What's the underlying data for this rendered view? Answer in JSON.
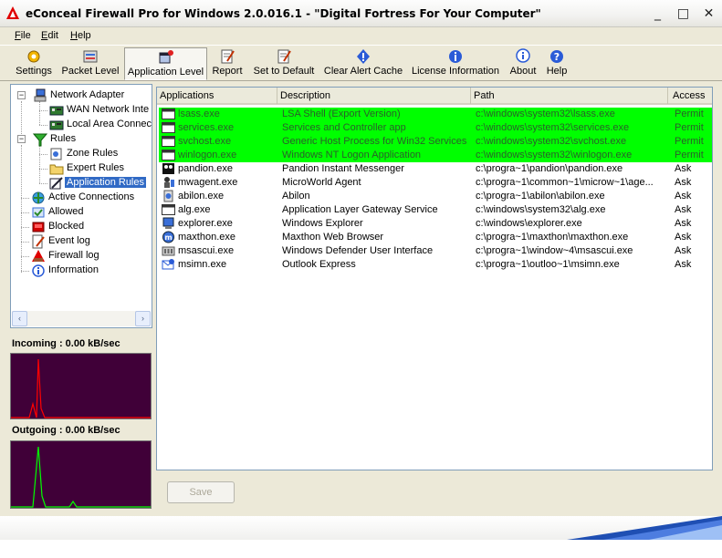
{
  "window": {
    "title": "eConceal Firewall Pro for Windows 2.0.016.1 - \"Digital Fortress For Your Computer\"",
    "minimize": "_",
    "maximize": "□",
    "close": "✕"
  },
  "menu": [
    {
      "label": "File",
      "accel": "F",
      "rest": "ile"
    },
    {
      "label": "Edit",
      "accel": "E",
      "rest": "dit"
    },
    {
      "label": "Help",
      "accel": "H",
      "rest": "elp"
    }
  ],
  "toolbar": [
    {
      "label": "Settings",
      "icon": "settings-icon"
    },
    {
      "label": "Packet Level",
      "icon": "packet-level-icon"
    },
    {
      "label": "Application Level",
      "icon": "application-level-icon",
      "active": true
    },
    {
      "label": "Report",
      "icon": "report-icon"
    },
    {
      "label": "Set to Default",
      "icon": "set-default-icon"
    },
    {
      "label": "Clear Alert Cache",
      "icon": "clear-alert-icon"
    },
    {
      "label": "License Information",
      "icon": "license-icon"
    },
    {
      "label": "About",
      "icon": "about-icon"
    },
    {
      "label": "Help",
      "icon": "help-icon"
    }
  ],
  "tree": {
    "network_adapter": "Network Adapter",
    "wan": "WAN Network Inte",
    "lan": "Local Area Connec",
    "rules": "Rules",
    "zone_rules": "Zone Rules",
    "expert_rules": "Expert Rules",
    "application_rules": "Application Rules",
    "active_connections": "Active Connections",
    "allowed": "Allowed",
    "blocked": "Blocked",
    "event_log": "Event log",
    "firewall_log": "Firewall log",
    "information": "Information",
    "expand_minus": "−",
    "scroll_left": "‹",
    "scroll_right": "›"
  },
  "graphs": {
    "incoming_label": "Incoming : 0.00 kB/sec",
    "outgoing_label": "Outgoing : 0.00 kB/sec",
    "incoming_color": "#ff0000",
    "outgoing_color": "#00ff00",
    "background": "#400038"
  },
  "list": {
    "headers": {
      "app": "Applications",
      "desc": "Description",
      "path": "Path",
      "access": "Access"
    },
    "rows": [
      {
        "app": "lsass.exe",
        "desc": "LSA Shell (Export Version)",
        "path": "c:\\windows\\system32\\lsass.exe",
        "access": "Permit",
        "highlight": true
      },
      {
        "app": "services.exe",
        "desc": "Services and Controller app",
        "path": "c:\\windows\\system32\\services.exe",
        "access": "Permit",
        "highlight": true
      },
      {
        "app": "svchost.exe",
        "desc": "Generic Host Process for Win32 Services",
        "path": "c:\\windows\\system32\\svchost.exe",
        "access": "Permit",
        "highlight": true
      },
      {
        "app": "winlogon.exe",
        "desc": "Windows NT Logon Application",
        "path": "c:\\windows\\system32\\winlogon.exe",
        "access": "Permit",
        "highlight": true
      },
      {
        "app": "pandion.exe",
        "desc": "Pandion Instant Messenger",
        "path": "c:\\progra~1\\pandion\\pandion.exe",
        "access": "Ask",
        "highlight": false
      },
      {
        "app": "mwagent.exe",
        "desc": "MicroWorld Agent",
        "path": "c:\\progra~1\\common~1\\microw~1\\age...",
        "access": "Ask",
        "highlight": false
      },
      {
        "app": "abilon.exe",
        "desc": "Abilon",
        "path": "c:\\progra~1\\abilon\\abilon.exe",
        "access": "Ask",
        "highlight": false
      },
      {
        "app": "alg.exe",
        "desc": "Application Layer Gateway Service",
        "path": "c:\\windows\\system32\\alg.exe",
        "access": "Ask",
        "highlight": false
      },
      {
        "app": "explorer.exe",
        "desc": "Windows Explorer",
        "path": "c:\\windows\\explorer.exe",
        "access": "Ask",
        "highlight": false
      },
      {
        "app": "maxthon.exe",
        "desc": "Maxthon Web Browser",
        "path": "c:\\progra~1\\maxthon\\maxthon.exe",
        "access": "Ask",
        "highlight": false
      },
      {
        "app": "msascui.exe",
        "desc": "Windows Defender User Interface",
        "path": "c:\\progra~1\\window~4\\msascui.exe",
        "access": "Ask",
        "highlight": false
      },
      {
        "app": "msimn.exe",
        "desc": "Outlook Express",
        "path": "c:\\progra~1\\outloo~1\\msimn.exe",
        "access": "Ask",
        "highlight": false
      }
    ]
  },
  "save_label": "Save",
  "colors": {
    "highlight_row": "#00ff00",
    "selection": "#316ac5"
  }
}
